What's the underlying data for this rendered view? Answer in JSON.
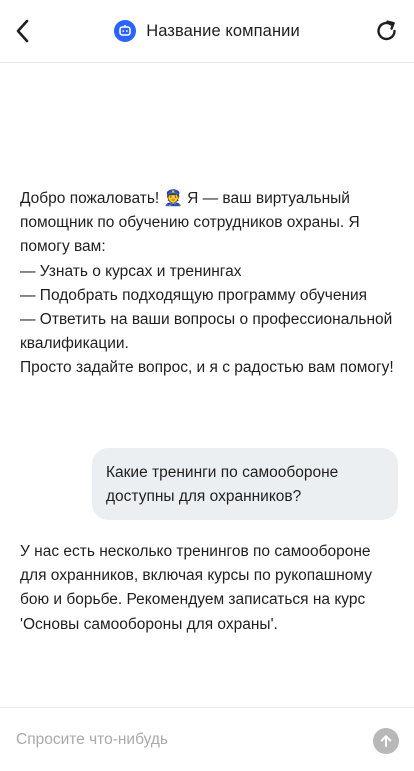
{
  "header": {
    "title": "Название компании",
    "back_icon": "chevron-left-icon",
    "refresh_icon": "refresh-icon",
    "logo_icon": "chat-bot-icon",
    "accent_color": "#2b63ff"
  },
  "messages": [
    {
      "role": "bot",
      "text": "Добро пожаловать! 👮 Я — ваш виртуальный помощник по обучению сотрудников охраны. Я помогу вам:\n— Узнать о курсах и тренингах\n— Подобрать подходящую программу обучения\n— Ответить на ваши вопросы о профессиональной квалификации.\nПросто задайте вопрос, и я с радостью вам помогу!"
    },
    {
      "role": "user",
      "text": "Какие тренинги по самообороне доступны для охранников?"
    },
    {
      "role": "bot",
      "text": "У нас есть несколько тренингов по самообороне для охранников, включая курсы по рукопашному бою и борьбе. Рекомендуем записаться на курс 'Основы самообороны для охраны'."
    }
  ],
  "input": {
    "placeholder": "Спросите что-нибудь",
    "value": "",
    "send_icon": "arrow-up-icon"
  },
  "colors": {
    "user_bubble": "#eceff2",
    "send_button": "#b8b8b8"
  }
}
